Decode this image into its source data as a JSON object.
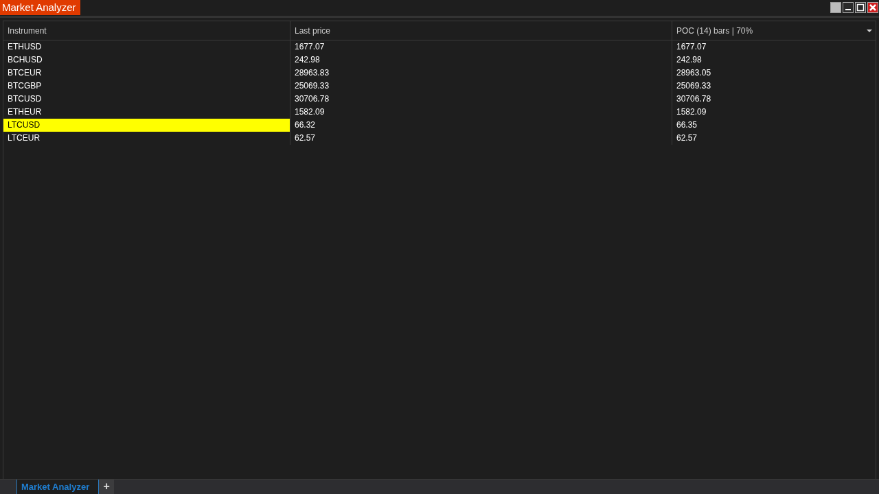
{
  "window": {
    "title": "Market Analyzer"
  },
  "table": {
    "columns": [
      {
        "label": "Instrument"
      },
      {
        "label": "Last price"
      },
      {
        "label": "POC (14) bars | 70%"
      }
    ],
    "rows": [
      {
        "cells": [
          "ETHUSD",
          "1677.07",
          "1677.07"
        ],
        "highlighted": false
      },
      {
        "cells": [
          "BCHUSD",
          "242.98",
          "242.98"
        ],
        "highlighted": false
      },
      {
        "cells": [
          "BTCEUR",
          "28963.83",
          "28963.05"
        ],
        "highlighted": false
      },
      {
        "cells": [
          "BTCGBP",
          "25069.33",
          "25069.33"
        ],
        "highlighted": false
      },
      {
        "cells": [
          "BTCUSD",
          "30706.78",
          "30706.78"
        ],
        "highlighted": false
      },
      {
        "cells": [
          "ETHEUR",
          "1582.09",
          "1582.09"
        ],
        "highlighted": false
      },
      {
        "cells": [
          "LTCUSD",
          "66.32",
          "66.35"
        ],
        "highlighted": true
      },
      {
        "cells": [
          "LTCEUR",
          "62.57",
          "62.57"
        ],
        "highlighted": false
      }
    ]
  },
  "tabs": [
    {
      "label": "Market Analyzer",
      "selected": true
    }
  ],
  "add_tab": "+"
}
